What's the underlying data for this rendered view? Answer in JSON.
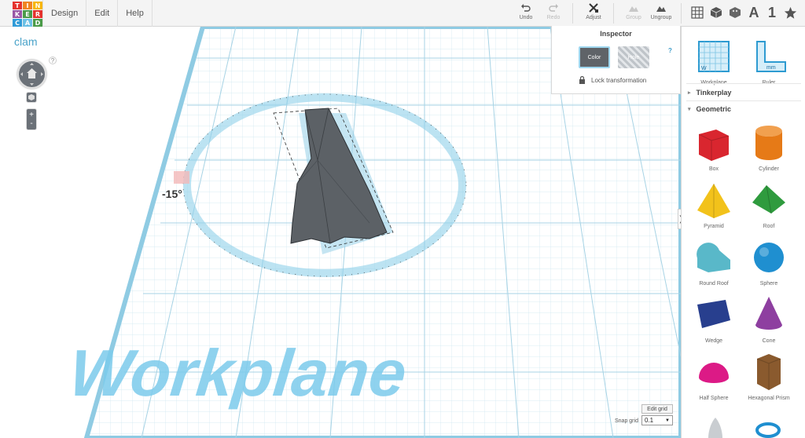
{
  "logo": {
    "letters": [
      "T",
      "I",
      "N",
      "K",
      "E",
      "R",
      "C",
      "A",
      "D"
    ],
    "colors": [
      "#e5322d",
      "#f08421",
      "#f7b500",
      "#9a57a6",
      "#4a9b48",
      "#e5322d",
      "#2f9bd8",
      "#6bc0e5",
      "#4a9b48"
    ]
  },
  "menu": {
    "items": [
      {
        "label": "Design"
      },
      {
        "label": "Edit"
      },
      {
        "label": "Help"
      }
    ]
  },
  "toolbar": {
    "undo_label": "Undo",
    "redo_label": "Redo",
    "adjust_label": "Adjust",
    "group_label": "Group",
    "ungroup_label": "Ungroup"
  },
  "view_controls": {
    "text_label": "A",
    "number_label": "1"
  },
  "project": {
    "name": "clam"
  },
  "help_glyph": "?",
  "nav": {
    "zoom_in": "+",
    "zoom_out": "-"
  },
  "inspector": {
    "title": "Inspector",
    "color_label": "Color",
    "hole_label": "Hole",
    "help": "?",
    "lock_label": "Lock transformation",
    "selected_color": "#5f6368"
  },
  "scene": {
    "workplane_text": "Workplane",
    "angle_readout": "-15°",
    "grid_color": "#b9dcea",
    "accent_color": "#3fa9d8"
  },
  "panel": {
    "top_items": [
      {
        "label": "Workplane"
      },
      {
        "label": "Ruler"
      }
    ],
    "sections": [
      {
        "label": "Tinkerplay",
        "expanded": false
      },
      {
        "label": "Geometric",
        "expanded": true
      }
    ],
    "shapes": [
      {
        "label": "Box",
        "color": "#d9262f"
      },
      {
        "label": "Cylinder",
        "color": "#e67a17"
      },
      {
        "label": "Pyramid",
        "color": "#f2c21b"
      },
      {
        "label": "Roof",
        "color": "#2f9b3e"
      },
      {
        "label": "Round Roof",
        "color": "#59b8c9"
      },
      {
        "label": "Sphere",
        "color": "#1f8fd0"
      },
      {
        "label": "Wedge",
        "color": "#283f8e"
      },
      {
        "label": "Cone",
        "color": "#8e3fa0"
      },
      {
        "label": "Half Sphere",
        "color": "#dc1a86"
      },
      {
        "label": "Hexagonal Prism",
        "color": "#8a5a2e"
      }
    ],
    "collapse_glyph": "❯"
  },
  "grid_controls": {
    "edit_grid_label": "Edit grid",
    "snap_label": "Snap grid",
    "snap_value": "0.1"
  }
}
